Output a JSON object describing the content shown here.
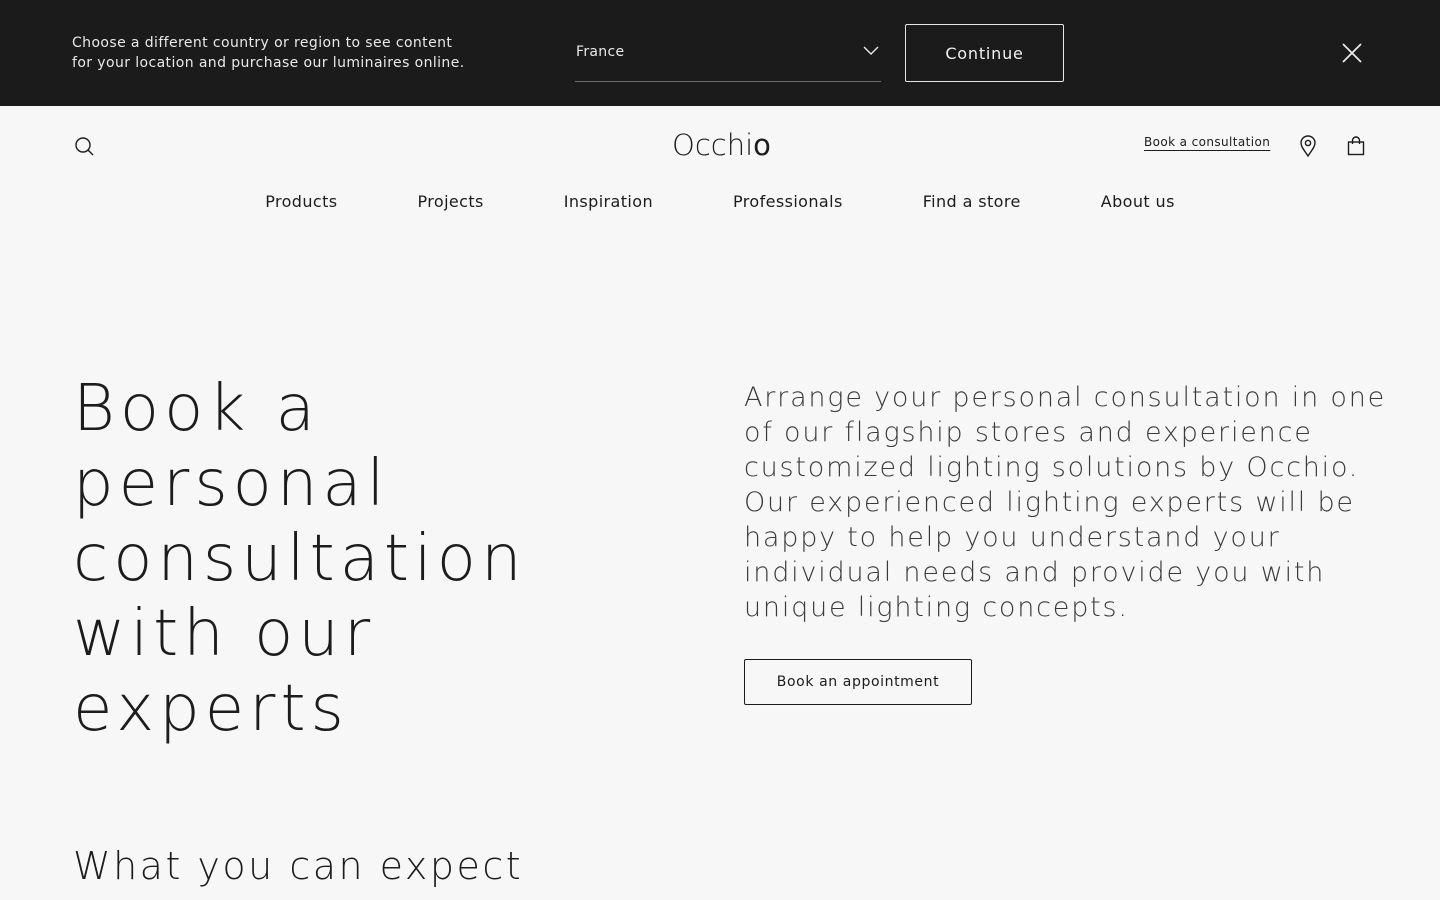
{
  "country_banner": {
    "message_line1": "Choose a different country or region to see content",
    "message_line2": "for your location and purchase our luminaires online.",
    "selected_country": "France",
    "continue_label": "Continue",
    "close_icon": "close-icon"
  },
  "header": {
    "logo_main": "Occhi",
    "logo_end": "o",
    "consultation_link": "Book a consultation",
    "icons": {
      "search": "search-icon",
      "store": "map-pin-icon",
      "cart": "shopping-bag-icon"
    }
  },
  "nav": {
    "items": [
      {
        "label": "Products"
      },
      {
        "label": "Projects"
      },
      {
        "label": "Inspiration"
      },
      {
        "label": "Professionals"
      },
      {
        "label": "Find a store"
      },
      {
        "label": "About us"
      }
    ]
  },
  "hero": {
    "title_lines": [
      "Book a",
      "personal",
      "consultation",
      "with our",
      "experts"
    ],
    "description_lines": [
      "Arrange your personal consultation in one",
      "of our flagship stores and experience",
      "customized lighting solutions by Occhio.",
      "Our experienced lighting experts will be",
      "happy to help you understand your",
      "individual needs and provide you with",
      "unique lighting concepts."
    ],
    "cta_label": "Book an appointment"
  },
  "expect_section": {
    "heading": "What you can expect"
  },
  "colors": {
    "banner_bg": "#1b1b1b",
    "page_bg": "#f7f7f7",
    "text": "#1c1c1c"
  }
}
